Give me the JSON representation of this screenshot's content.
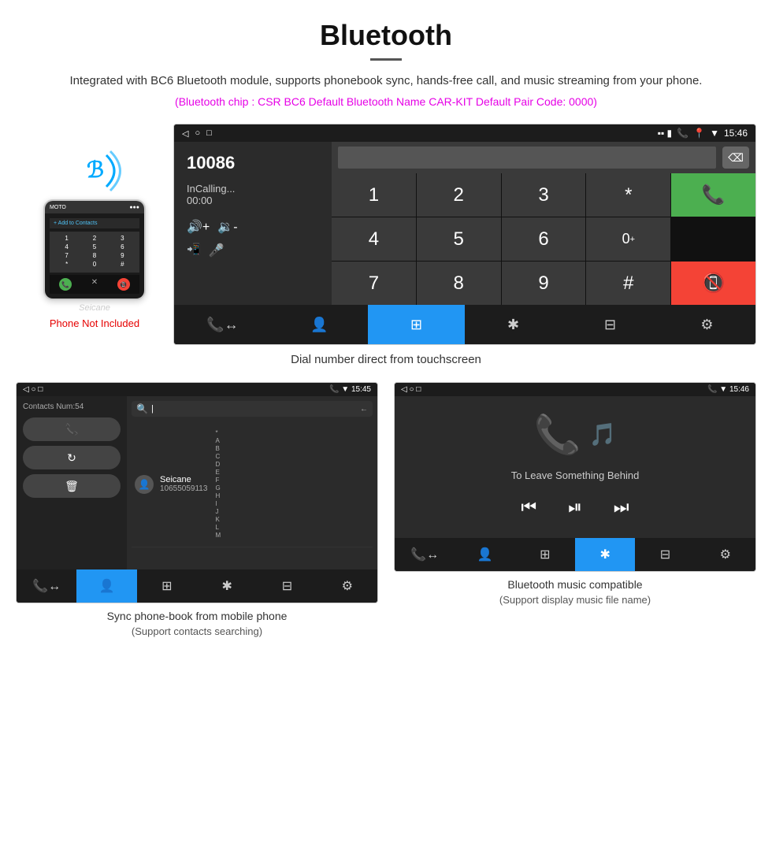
{
  "page": {
    "title": "Bluetooth",
    "divider": true,
    "description": "Integrated with BC6 Bluetooth module, supports phonebook sync, hands-free call, and music streaming from your phone.",
    "specs": "(Bluetooth chip : CSR BC6    Default Bluetooth Name CAR-KIT    Default Pair Code: 0000)"
  },
  "phone_label": "Phone Not Included",
  "seicane_watermark": "Seicane",
  "main_screen": {
    "status_bar": {
      "left": [
        "◁",
        "○",
        "□"
      ],
      "right_icons": "📞 📍 ▼",
      "time": "15:46"
    },
    "dialer": {
      "number": "10086",
      "status": "InCalling...",
      "time": "00:00"
    },
    "keypad": {
      "keys": [
        "1",
        "2",
        "3",
        "*",
        "",
        "4",
        "5",
        "6",
        "0+",
        "",
        "7",
        "8",
        "9",
        "#",
        ""
      ]
    },
    "nav": [
      {
        "icon": "📞↔",
        "label": "calls",
        "active": false
      },
      {
        "icon": "👤",
        "label": "contacts",
        "active": false
      },
      {
        "icon": "⊞",
        "label": "dialpad",
        "active": true
      },
      {
        "icon": "✱",
        "label": "bluetooth",
        "active": false
      },
      {
        "icon": "⊟",
        "label": "transfer",
        "active": false
      },
      {
        "icon": "⚙",
        "label": "settings",
        "active": false
      }
    ]
  },
  "caption": "Dial number direct from touchscreen",
  "bottom_left": {
    "status_bar_time": "15:45",
    "contacts_num": "Contacts Num:54",
    "contact_name": "Seicane",
    "contact_phone": "10655059113",
    "caption": "Sync phone-book from mobile phone",
    "caption_sub": "(Support contacts searching)"
  },
  "bottom_right": {
    "status_bar_time": "15:46",
    "song_title": "To Leave Something Behind",
    "caption": "Bluetooth music compatible",
    "caption_sub": "(Support display music file name)"
  },
  "icons": {
    "bluetooth": "⚡",
    "phone_call": "📞",
    "phone_end": "📵",
    "vol_up": "🔊",
    "vol_down": "🔉",
    "mute": "🔇",
    "mic": "🎤",
    "transfer": "📲",
    "search": "🔍",
    "music_note": "🎵",
    "prev": "⏮",
    "next": "⏭",
    "play": "⏯",
    "back": "✕"
  }
}
